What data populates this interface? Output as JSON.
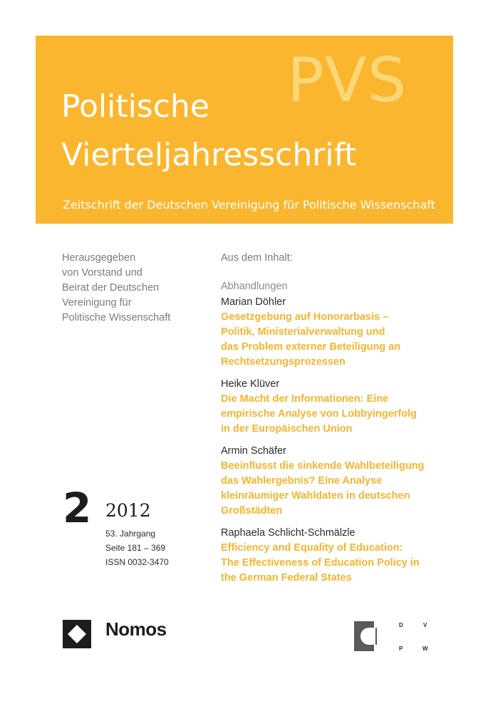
{
  "cover": {
    "acronym": "PVS",
    "title_line1": "Politische",
    "title_line2": "Vierteljahresschrift",
    "subtitle": "Zeitschrift der Deutschen Vereinigung für Politische Wissenschaft"
  },
  "editors": [
    "Herausgegeben",
    "von Vorstand und",
    "Beirat der Deutschen",
    "Vereinigung für",
    "Politische Wissenschaft"
  ],
  "contents": {
    "heading": "Aus dem Inhalt:",
    "section": "Abhandlungen",
    "articles": [
      {
        "author": "Marian Döhler",
        "title_lines": [
          "Gesetzgebung auf Honorarbasis –",
          "Politik, Ministerialverwaltung und",
          "das Problem externer Beteiligung an",
          "Rechtsetzungsprozessen"
        ]
      },
      {
        "author": "Heike Klüver",
        "title_lines": [
          "Die Macht der Informationen: Eine",
          "empirische Analyse von Lobbyingerfolg",
          "in der Europäischen Union"
        ]
      },
      {
        "author": "Armin Schäfer",
        "title_lines": [
          "Beeinflusst die sinkende Wahlbeteiligung",
          "das Wahlergebnis? Eine Analyse",
          "kleinräumiger Wahldaten in deutschen",
          "Großstädten"
        ]
      },
      {
        "author": "Raphaela Schlicht-Schmälzle",
        "title_lines": [
          "Efficiency and Equality of Education:",
          "The Effectiveness of Education Policy in",
          "the German Federal States"
        ]
      }
    ]
  },
  "issue": {
    "number": "2",
    "year": "2012",
    "volume": "53. Jahrgang",
    "pages": "Seite 181 – 369",
    "issn": "ISSN 0032-3470"
  },
  "publisher": {
    "name": "Nomos",
    "logo_color": "#1d1d1d"
  },
  "association_logo": {
    "letters": [
      "D",
      "V",
      "P",
      "W"
    ]
  },
  "colors": {
    "band": "#fbb62f",
    "accent_text": "#f6b52f",
    "acronym": "#fdd777"
  }
}
